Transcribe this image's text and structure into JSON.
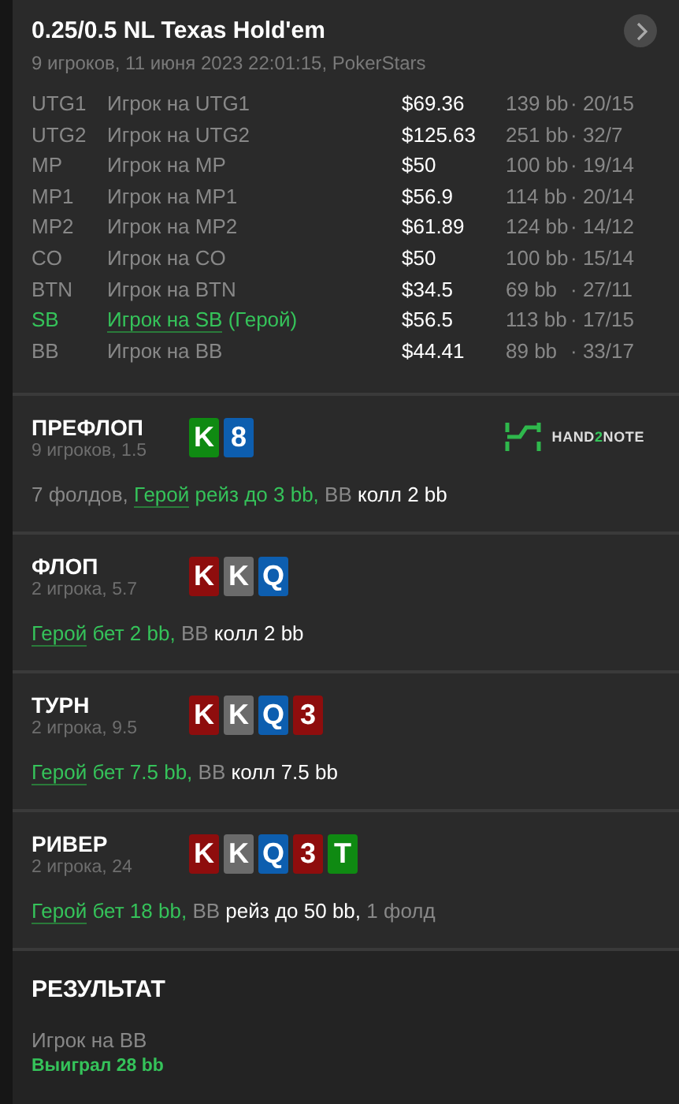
{
  "header": {
    "title": "0.25/0.5 NL Texas Hold'em",
    "subtitle": "9 игроков, 11 июня 2023 22:01:15, PokerStars"
  },
  "players": [
    {
      "position": "UTG1",
      "name": "Игрок на UTG1",
      "hero": false,
      "stack": "$69.36",
      "bb": "139 bb",
      "stats": "· 20/15"
    },
    {
      "position": "UTG2",
      "name": "Игрок на UTG2",
      "hero": false,
      "stack": "$125.63",
      "bb": "251 bb",
      "stats": "· 32/7"
    },
    {
      "position": "MP",
      "name": "Игрок на MP",
      "hero": false,
      "stack": "$50",
      "bb": "100 bb",
      "stats": "· 19/14"
    },
    {
      "position": "MP1",
      "name": "Игрок на MP1",
      "hero": false,
      "stack": "$56.9",
      "bb": "114 bb",
      "stats": "· 20/14"
    },
    {
      "position": "MP2",
      "name": "Игрок на MP2",
      "hero": false,
      "stack": "$61.89",
      "bb": "124 bb",
      "stats": "· 14/12"
    },
    {
      "position": "CO",
      "name": "Игрок на CO",
      "hero": false,
      "stack": "$50",
      "bb": "100 bb",
      "stats": "· 15/14"
    },
    {
      "position": "BTN",
      "name": "Игрок на BTN",
      "hero": false,
      "stack": "$34.5",
      "bb": "69 bb",
      "stats": "· 27/11"
    },
    {
      "position": "SB",
      "name": "Игрок на SB",
      "note": "(Герой)",
      "hero": true,
      "stack": "$56.5",
      "bb": "113 bb",
      "stats": "· 17/15"
    },
    {
      "position": "BB",
      "name": "Игрок на BB",
      "hero": false,
      "stack": "$44.41",
      "bb": "89 bb",
      "stats": "· 33/17"
    }
  ],
  "logo": {
    "parts": [
      "HAND",
      "2",
      "NOTE"
    ]
  },
  "streets": [
    {
      "title": "ПРЕФЛОП",
      "subtitle": "9 игроков, 1.5",
      "cards": [
        {
          "rank": "K",
          "color": "#0f8a12"
        },
        {
          "rank": "8",
          "color": "#0d5eaf"
        }
      ],
      "actions": [
        {
          "kind": "folds",
          "text": "7 фолдов,"
        },
        {
          "kind": "hero",
          "player": "Герой",
          "text": "рейз до 3 bb,"
        },
        {
          "kind": "opponent",
          "player": "BB",
          "text": "колл 2 bb"
        }
      ]
    },
    {
      "title": "ФЛОП",
      "subtitle": "2 игрока, 5.7",
      "cards": [
        {
          "rank": "K",
          "color": "#8e0d0d"
        },
        {
          "rank": "K",
          "color": "#6b6b6b"
        },
        {
          "rank": "Q",
          "color": "#0d5eaf"
        }
      ],
      "actions": [
        {
          "kind": "hero",
          "player": "Герой",
          "text": "бет 2 bb,"
        },
        {
          "kind": "opponent",
          "player": "BB",
          "text": "колл 2 bb"
        }
      ]
    },
    {
      "title": "ТУРН",
      "subtitle": "2 игрока, 9.5",
      "cards": [
        {
          "rank": "K",
          "color": "#8e0d0d"
        },
        {
          "rank": "K",
          "color": "#6b6b6b"
        },
        {
          "rank": "Q",
          "color": "#0d5eaf"
        },
        {
          "rank": "3",
          "color": "#8e0d0d"
        }
      ],
      "actions": [
        {
          "kind": "hero",
          "player": "Герой",
          "text": "бет 7.5 bb,"
        },
        {
          "kind": "opponent",
          "player": "BB",
          "text": "колл 7.5 bb"
        }
      ]
    },
    {
      "title": "РИВЕР",
      "subtitle": "2 игрока, 24",
      "cards": [
        {
          "rank": "K",
          "color": "#8e0d0d"
        },
        {
          "rank": "K",
          "color": "#6b6b6b"
        },
        {
          "rank": "Q",
          "color": "#0d5eaf"
        },
        {
          "rank": "3",
          "color": "#8e0d0d"
        },
        {
          "rank": "T",
          "color": "#0f8a12"
        }
      ],
      "actions": [
        {
          "kind": "hero",
          "player": "Герой",
          "text": "бет 18 bb,"
        },
        {
          "kind": "opponent",
          "player": "BB",
          "text": "рейз до 50 bb,"
        },
        {
          "kind": "folds",
          "text": "1 фолд"
        }
      ]
    }
  ],
  "result": {
    "title": "РЕЗУЛЬТАТ",
    "winner": "Игрок на BB",
    "outcome": "Выиграл 28 bb"
  }
}
